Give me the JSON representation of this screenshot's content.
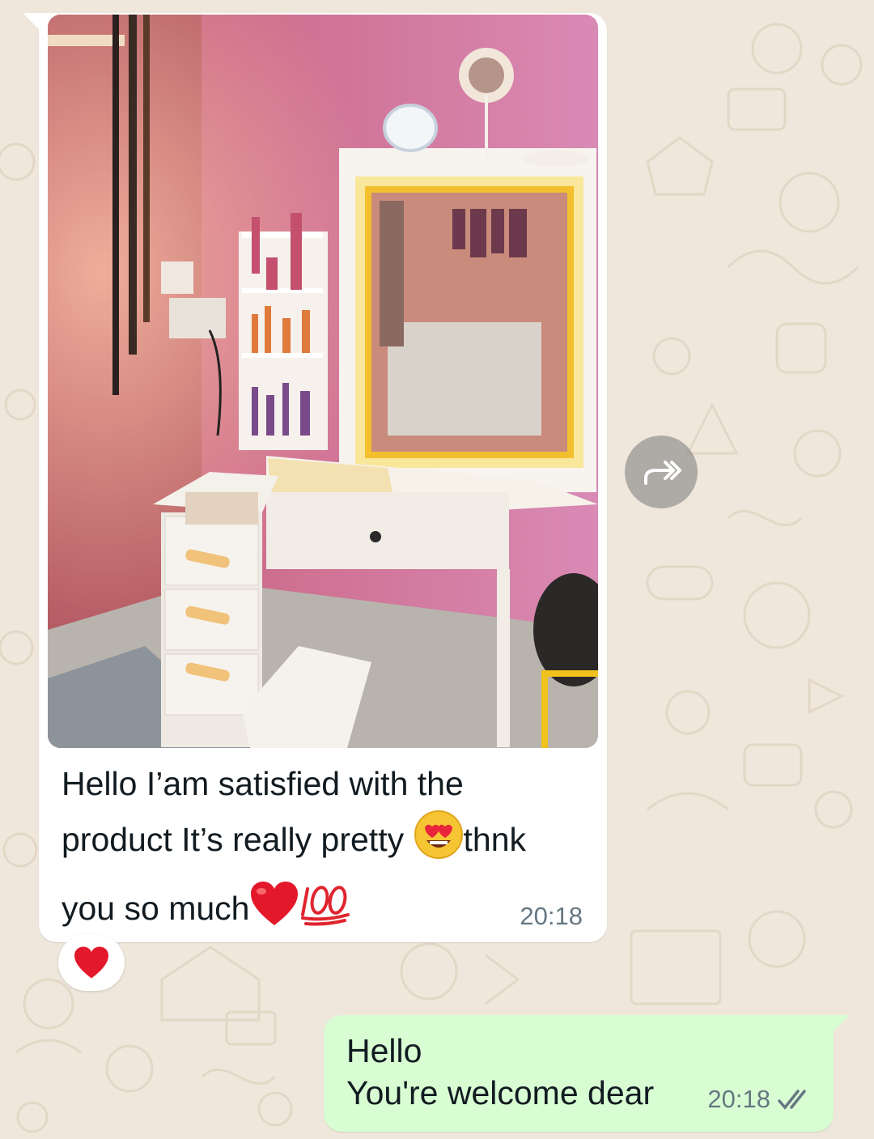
{
  "wallpaper": {
    "color": "#efe7dc",
    "doodle_color": "#e3d7c6"
  },
  "incoming_message": {
    "caption_line1": "Hello I’am satisfied with the",
    "caption_line2_a": "product It’s really pretty",
    "caption_line2_b": "thnk",
    "caption_line3_a": "you so much",
    "emojis": [
      "heart-eyes-emoji",
      "red-heart-emoji",
      "hundred-points-emoji"
    ],
    "time": "20:18",
    "reaction": "red-heart"
  },
  "forward_button": {
    "icon": "forward-icon"
  },
  "outgoing_message": {
    "line1": "Hello",
    "line2": "You're welcome dear",
    "time": "20:18",
    "status_icon": "double-check-icon"
  }
}
